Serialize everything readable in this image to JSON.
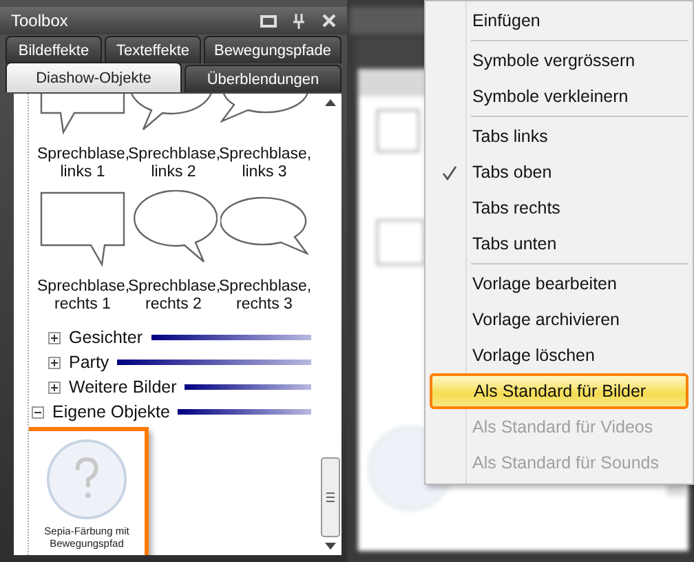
{
  "toolbox": {
    "title": "Toolbox",
    "tab_rows": [
      [
        {
          "label": "Bildeffekte",
          "selected": false
        },
        {
          "label": "Texteffekte",
          "selected": false
        },
        {
          "label": "Bewegungspfade",
          "selected": false
        }
      ],
      [
        {
          "label": "Diashow-Objekte",
          "selected": true
        },
        {
          "label": "Überblendungen",
          "selected": false
        }
      ]
    ],
    "gallery": [
      {
        "label": "Sprechblase, links 1",
        "kind": "box-left"
      },
      {
        "label": "Sprechblase, links 2",
        "kind": "oval-left"
      },
      {
        "label": "Sprechblase, links 3",
        "kind": "wide-left"
      },
      {
        "label": "Sprechblase, rechts 1",
        "kind": "box-right"
      },
      {
        "label": "Sprechblase, rechts 2",
        "kind": "oval-right"
      },
      {
        "label": "Sprechblase, rechts 3",
        "kind": "wide-right"
      }
    ],
    "groups": [
      {
        "label": "Gesichter",
        "expanded": false
      },
      {
        "label": "Party",
        "expanded": false
      },
      {
        "label": "Weitere Bilder",
        "expanded": false
      },
      {
        "label": "Eigene Objekte",
        "expanded": true,
        "objects": [
          {
            "label": "Sepia-Färbung mit Bewegungspfad",
            "selected": true
          }
        ]
      }
    ]
  },
  "context_menu": [
    {
      "kind": "item",
      "label": "Einfügen",
      "checked": false,
      "disabled": false,
      "selected": false
    },
    {
      "kind": "separator"
    },
    {
      "kind": "item",
      "label": "Symbole vergrössern",
      "checked": false,
      "disabled": false,
      "selected": false
    },
    {
      "kind": "item",
      "label": "Symbole verkleinern",
      "checked": false,
      "disabled": false,
      "selected": false
    },
    {
      "kind": "separator"
    },
    {
      "kind": "item",
      "label": "Tabs links",
      "checked": false,
      "disabled": false,
      "selected": false
    },
    {
      "kind": "item",
      "label": "Tabs oben",
      "checked": true,
      "disabled": false,
      "selected": false
    },
    {
      "kind": "item",
      "label": "Tabs rechts",
      "checked": false,
      "disabled": false,
      "selected": false
    },
    {
      "kind": "item",
      "label": "Tabs unten",
      "checked": false,
      "disabled": false,
      "selected": false
    },
    {
      "kind": "separator"
    },
    {
      "kind": "item",
      "label": "Vorlage bearbeiten",
      "checked": false,
      "disabled": false,
      "selected": false
    },
    {
      "kind": "item",
      "label": "Vorlage archivieren",
      "checked": false,
      "disabled": false,
      "selected": false
    },
    {
      "kind": "item",
      "label": "Vorlage löschen",
      "checked": false,
      "disabled": false,
      "selected": false
    },
    {
      "kind": "item",
      "label": "Als Standard für Bilder",
      "checked": false,
      "disabled": false,
      "selected": true
    },
    {
      "kind": "item",
      "label": "Als Standard für Videos",
      "checked": false,
      "disabled": true,
      "selected": false
    },
    {
      "kind": "item",
      "label": "Als Standard für Sounds",
      "checked": false,
      "disabled": true,
      "selected": false
    }
  ]
}
